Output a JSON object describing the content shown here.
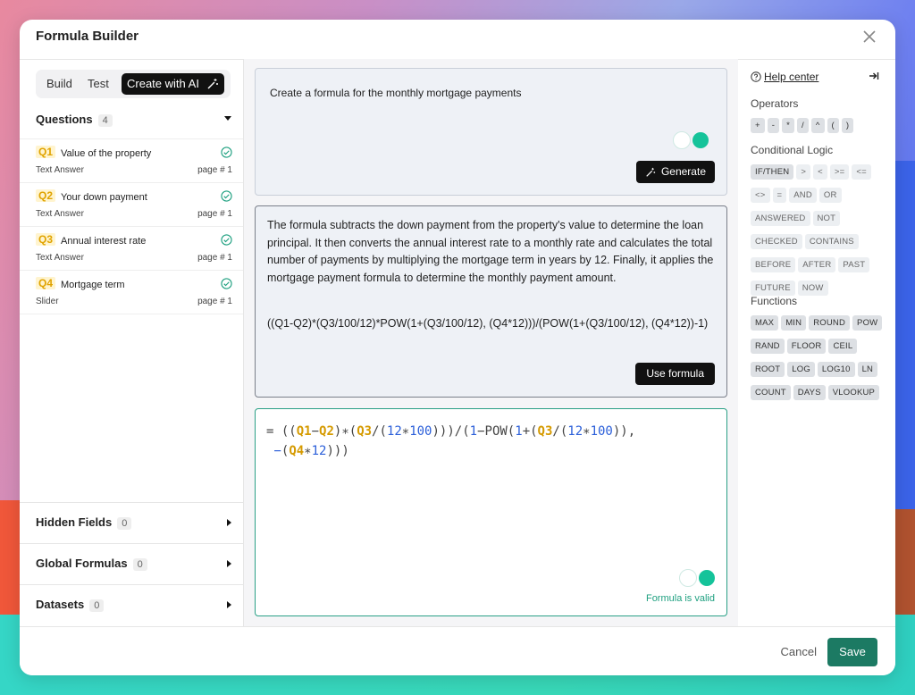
{
  "modal": {
    "title": "Formula Builder"
  },
  "tabs": [
    {
      "label": "Build"
    },
    {
      "label": "Test"
    },
    {
      "label": "Create with AI"
    }
  ],
  "questions": {
    "title": "Questions",
    "count": "4",
    "items": [
      {
        "tag": "Q1",
        "name": "Value of the property",
        "type": "Text Answer",
        "page": "page # 1"
      },
      {
        "tag": "Q2",
        "name": "Your down payment",
        "type": "Text Answer",
        "page": "page # 1"
      },
      {
        "tag": "Q3",
        "name": "Annual interest rate",
        "type": "Text Answer",
        "page": "page # 1"
      },
      {
        "tag": "Q4",
        "name": "Mortgage term",
        "type": "Slider",
        "page": "page # 1"
      }
    ]
  },
  "sections": [
    {
      "label": "Hidden Fields",
      "count": "0"
    },
    {
      "label": "Global Formulas",
      "count": "0"
    },
    {
      "label": "Datasets",
      "count": "0"
    }
  ],
  "ai": {
    "prompt": "Create a formula for the monthly mortgage payments",
    "generate_label": "Generate",
    "explanation": "The formula subtracts the down payment from the property's value to determine the loan principal. It then converts the annual interest rate to a monthly rate and calculates the total number of payments by multiplying the mortgage term in years by 12. Finally, it applies the mortgage payment formula to determine the monthly payment amount.",
    "formula": "((Q1-Q2)*(Q3/100/12)*POW(1+(Q3/100/12), (Q4*12)))/(POW(1+(Q3/100/12), (Q4*12))-1)",
    "use_label": "Use formula"
  },
  "editor": {
    "tokens": {
      "eq": "=",
      "p1": "((",
      "q1": "Q1",
      "minus1": "−",
      "q2": "Q2",
      "p2": ")∗(",
      "q3a": "Q3",
      "p3": "/(",
      "n12a": "12",
      "mul1": "∗",
      "n100a": "100",
      "p4": ")))/(",
      "n1a": "1",
      "pow": "−POW(",
      "n1b": "1",
      "p5": "+(",
      "q3b": "Q3",
      "p6": "/(",
      "n12b": "12",
      "mul2": "∗",
      "n100b": "100",
      "p7": ")),",
      "dash": "−",
      "p8": "(",
      "q4": "Q4",
      "mul3": "∗",
      "n12c": "12",
      "p9": ")))"
    },
    "status": "Formula is valid"
  },
  "right": {
    "help": "Help center",
    "operators_title": "Operators",
    "operators": [
      "+",
      "-",
      "*",
      "/",
      "^",
      "(",
      ")"
    ],
    "logic_title": "Conditional Logic",
    "logic": [
      "IF/THEN",
      ">",
      "<",
      ">=",
      "<=",
      "<>",
      "=",
      "AND",
      "OR",
      "ANSWERED",
      "NOT",
      "CHECKED",
      "CONTAINS",
      "BEFORE",
      "AFTER",
      "PAST",
      "FUTURE",
      "NOW"
    ],
    "functions_title": "Functions",
    "functions": [
      "MAX",
      "MIN",
      "ROUND",
      "POW",
      "RAND",
      "FLOOR",
      "CEIL",
      "ROOT",
      "LOG",
      "LOG10",
      "LN",
      "COUNT",
      "DAYS",
      "VLOOKUP"
    ]
  },
  "footer": {
    "cancel": "Cancel",
    "save": "Save"
  },
  "colors": {
    "accent": "#1c7a63",
    "valid": "#1fa080",
    "question_tag": "#e0a300"
  }
}
